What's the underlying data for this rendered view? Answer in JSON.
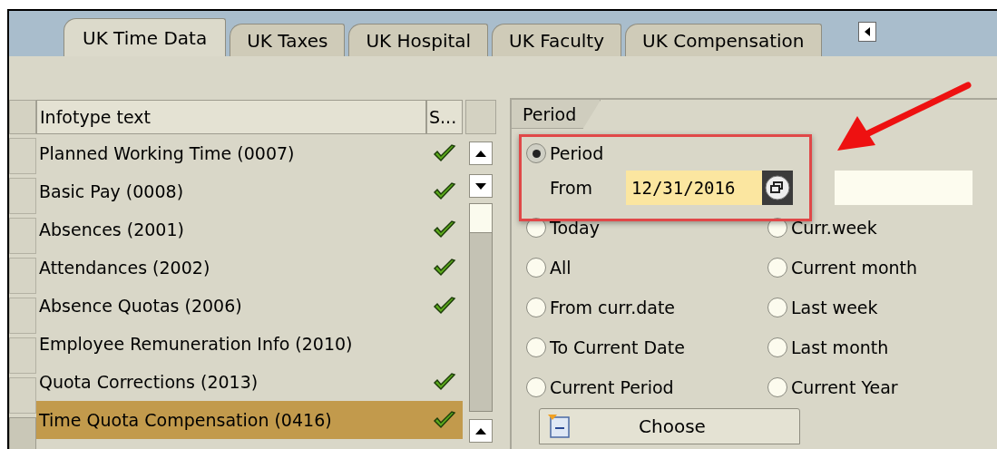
{
  "tabs": [
    {
      "label": "UK Time Data",
      "selected": true
    },
    {
      "label": "UK Taxes",
      "selected": false
    },
    {
      "label": "UK Hospital",
      "selected": false
    },
    {
      "label": "UK Faculty",
      "selected": false
    },
    {
      "label": "UK Compensation",
      "selected": false
    }
  ],
  "table": {
    "columns": [
      "Infotype text",
      "S..."
    ],
    "rows": [
      {
        "name": "Planned Working Time (0007)",
        "checked": true,
        "selected": false
      },
      {
        "name": "Basic Pay (0008)",
        "checked": true,
        "selected": false
      },
      {
        "name": "Absences (2001)",
        "checked": true,
        "selected": false
      },
      {
        "name": "Attendances (2002)",
        "checked": true,
        "selected": false
      },
      {
        "name": "Absence Quotas (2006)",
        "checked": true,
        "selected": false
      },
      {
        "name": "Employee Remuneration Info (2010)",
        "checked": false,
        "selected": false
      },
      {
        "name": "Quota Corrections (2013)",
        "checked": true,
        "selected": false
      },
      {
        "name": "Time Quota Compensation (0416)",
        "checked": true,
        "selected": true
      }
    ]
  },
  "period_group": {
    "title": "Period",
    "period_option": {
      "label": "Period",
      "selected": true
    },
    "from": {
      "label": "From",
      "value": "12/31/2016"
    },
    "options": [
      {
        "label": "Today",
        "selected": false
      },
      {
        "label": "Curr.week",
        "selected": false
      },
      {
        "label": "All",
        "selected": false
      },
      {
        "label": "Current month",
        "selected": false
      },
      {
        "label": "From curr.date",
        "selected": false
      },
      {
        "label": "Last week",
        "selected": false
      },
      {
        "label": "To Current Date",
        "selected": false
      },
      {
        "label": "Last month",
        "selected": false
      },
      {
        "label": "Current Period",
        "selected": false
      },
      {
        "label": "Current Year",
        "selected": false
      }
    ],
    "choose_button": "Choose"
  }
}
